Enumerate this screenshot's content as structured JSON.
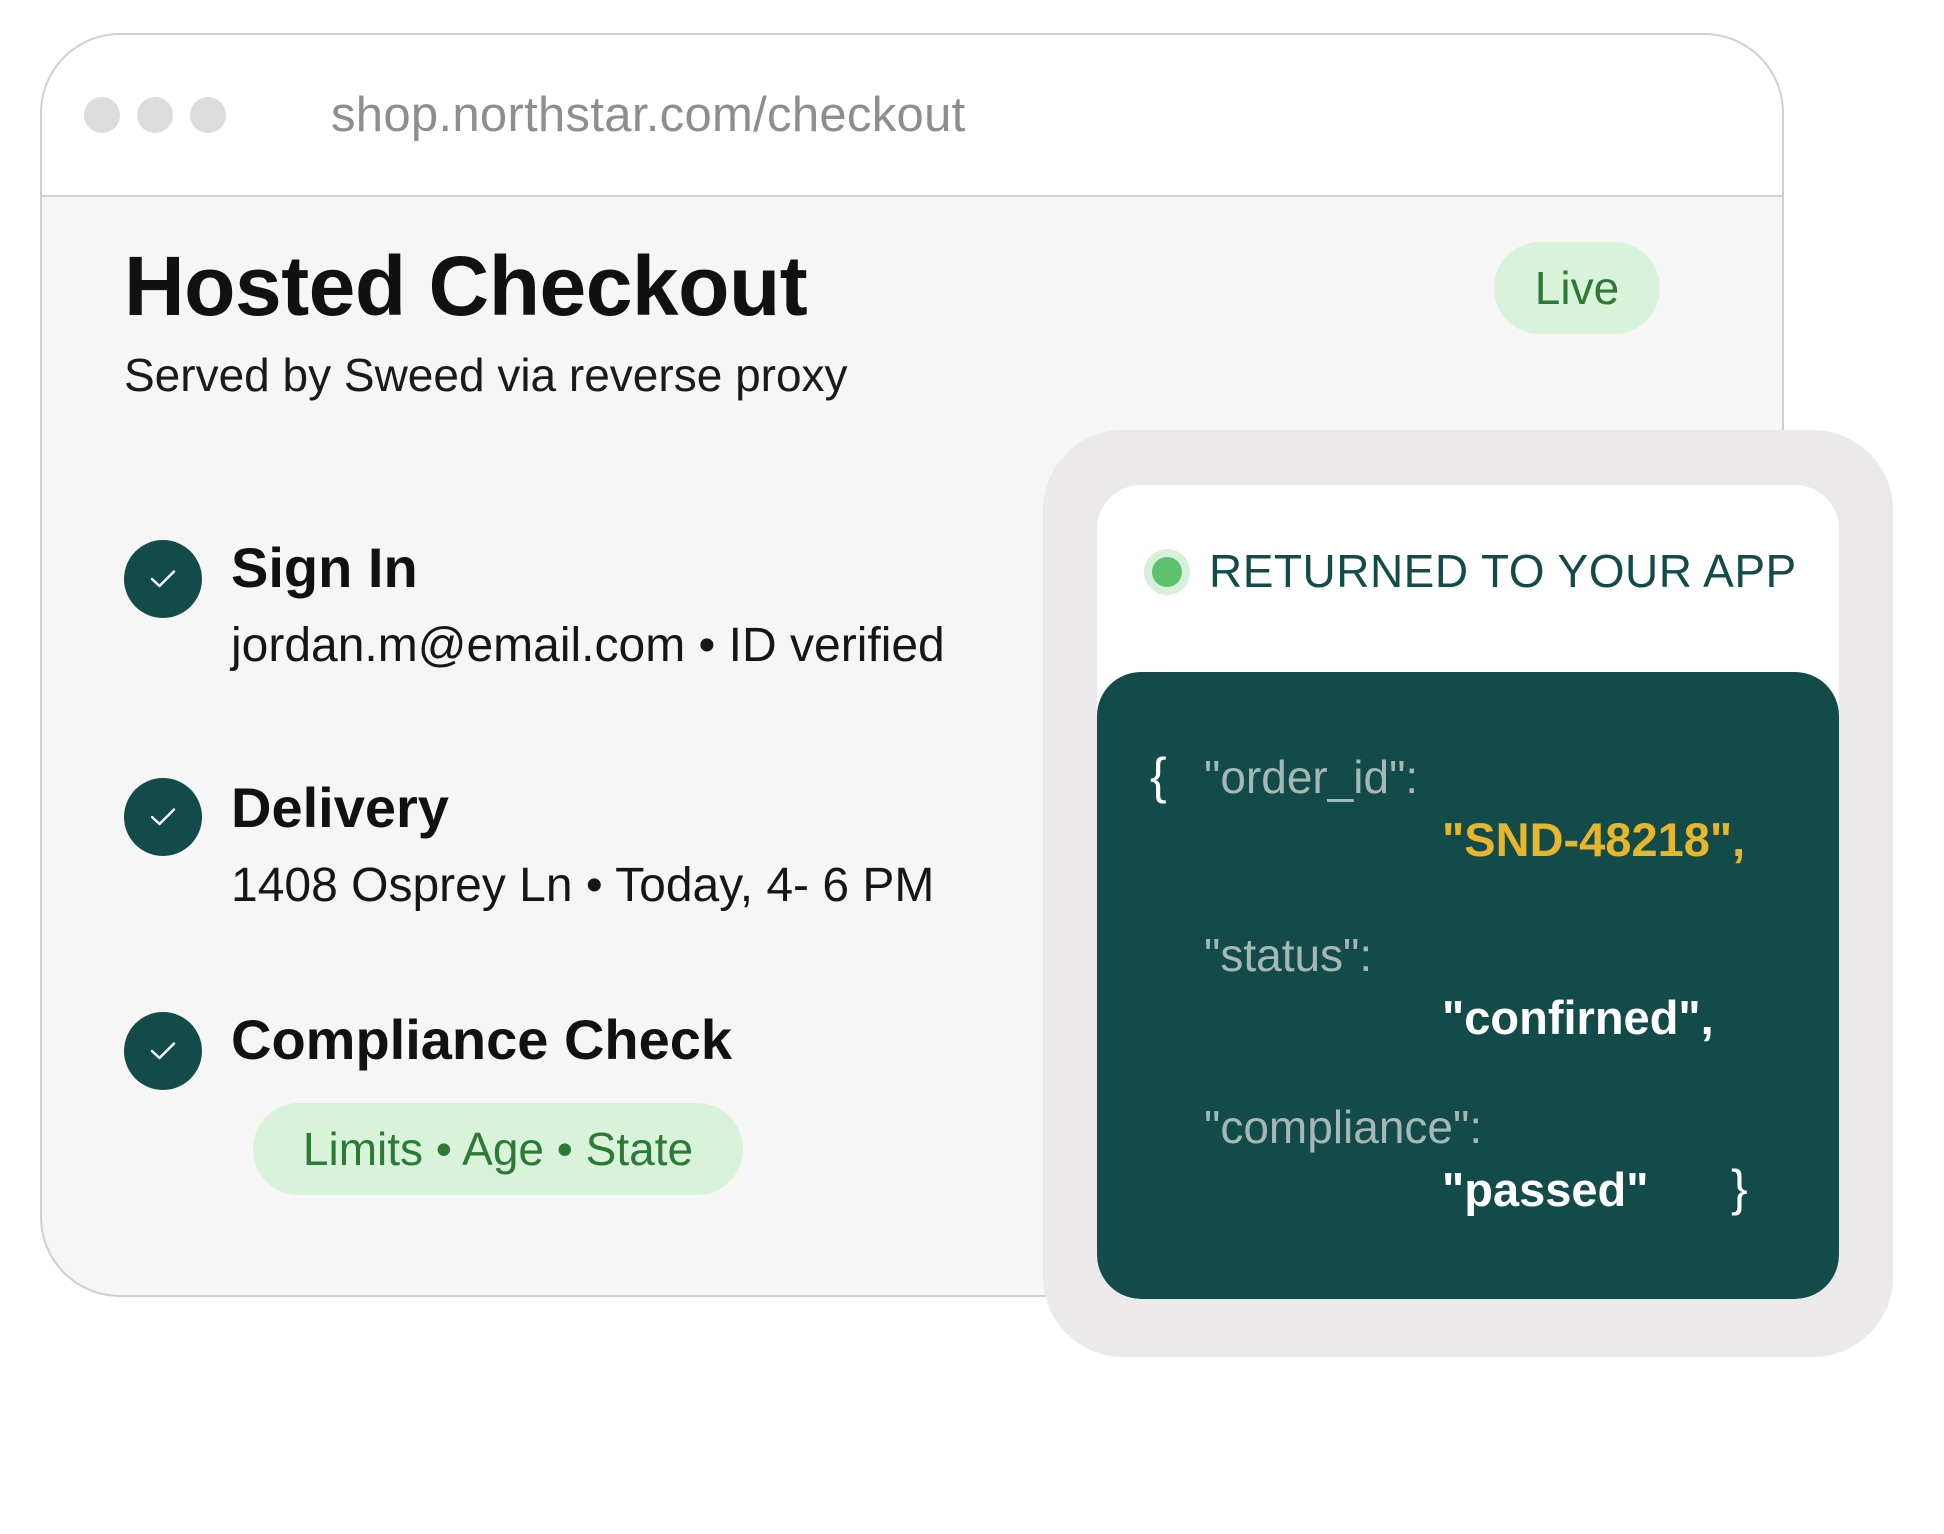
{
  "browser": {
    "url": "shop.northstar.com/checkout"
  },
  "checkout": {
    "title": "Hosted Checkout",
    "subtitle": "Served by Sweed via reverse proxy",
    "badge": "Live",
    "steps": [
      {
        "title": "Sign In",
        "detail": "jordan.m@email.com • ID verified",
        "status": "complete",
        "icon": "check-icon"
      },
      {
        "title": "Delivery",
        "detail": "1408 Osprey Ln • Today, 4- 6 PM",
        "status": "complete",
        "icon": "check-icon"
      },
      {
        "title": "Compliance Check",
        "tag": "Limits • Age • State",
        "status": "complete",
        "icon": "check-icon"
      }
    ]
  },
  "app_card": {
    "title": "RETURNED TO YOUR APP",
    "status_icon": "green-status-dot",
    "code": {
      "open_brace": "{",
      "close_brace": "}",
      "order_id_key": "\"order_id\":",
      "order_id_value": "\"SND-48218\",",
      "status_key": "\"status\":",
      "status_value": "\"confirned\",",
      "compliance_key": "\"compliance\":",
      "compliance_value": "\"passed\""
    }
  },
  "colors": {
    "brand_dark_teal": "#124b4a",
    "success_green": "#2c7a36",
    "success_bg": "#d9f2da",
    "accent_yellow": "#e8b62a",
    "status_dot": "#5cc06e"
  }
}
